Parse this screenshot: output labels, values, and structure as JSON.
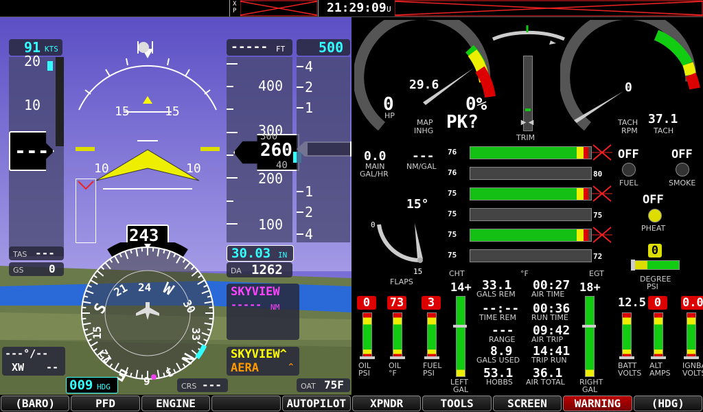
{
  "topbar": {
    "xp_label": "X P",
    "clock": "21:29:09",
    "clock_suffix": "U"
  },
  "pfd": {
    "airspeed": {
      "value": "91",
      "unit": "KTS",
      "pointer": "---",
      "ticks": [
        "20",
        "10"
      ]
    },
    "altitude": {
      "selected": "-----",
      "selected_unit": "FT",
      "vs_bug": "500",
      "ticks": [
        "400",
        "300",
        "200",
        "100"
      ],
      "current": "260",
      "roll_above": "300",
      "roll_below": "40"
    },
    "vsi_ticks": [
      "4",
      "2",
      "1",
      "1",
      "2",
      "4"
    ],
    "pitch_labels": {
      "up15_left": "15",
      "up15_right": "15",
      "down10_left": "10",
      "down10_right": "10"
    },
    "tas": {
      "label": "TAS",
      "value": "---"
    },
    "gs": {
      "label": "GS",
      "value": "0"
    },
    "baro": {
      "value": "30.03",
      "unit": "IN"
    },
    "da": {
      "label": "DA",
      "value": "1262"
    },
    "heading": {
      "value": "243",
      "bug": "009",
      "bug_unit": "HDG",
      "labels": [
        "24",
        "W",
        "30",
        "33",
        "N",
        "3",
        "E",
        "12",
        "15",
        "S",
        "21",
        "6"
      ]
    },
    "nav": {
      "source": "SKYVIEW",
      "dist": "-----",
      "dist_unit": "NM"
    },
    "nav2": {
      "line1": "SKYVIEW^",
      "line2": "AERA"
    },
    "wind": {
      "line1": "---°/--",
      "xw_label": "XW",
      "xw_value": "--"
    },
    "crs": {
      "label": "CRS",
      "value": "---"
    },
    "oat": {
      "label": "OAT",
      "value": "75F"
    }
  },
  "engine": {
    "map": {
      "value": "29.6",
      "label1": "MAP",
      "label2": "INHG"
    },
    "hp": {
      "value": "0",
      "label": "HP"
    },
    "pct": {
      "value": "0%",
      "peak": "PK?"
    },
    "trim": {
      "label": "TRIM"
    },
    "tach": {
      "needle": "0",
      "value": "37.1",
      "label1": "TACH",
      "label2": "RPM",
      "label_right": "TACH"
    },
    "fuel_flow": {
      "value": "0.0",
      "label1": "MAIN",
      "label2": "GAL/HR"
    },
    "nm_gal": {
      "value": "---",
      "label": "NM/GAL"
    },
    "cyl": {
      "cht": [
        "76",
        "76",
        "75",
        "75",
        "75",
        "75"
      ],
      "egt": [
        "",
        "80",
        "",
        "75",
        "",
        "72"
      ],
      "fill": [
        0.98,
        0,
        0.98,
        0,
        0.98,
        0
      ],
      "cht_label": "CHT",
      "unit_label": "°F",
      "egt_label": "EGT"
    },
    "flaps": {
      "deg": "15°",
      "min": "0",
      "max": "15",
      "label": "FLAPS"
    },
    "fuel_pump": {
      "state": "OFF",
      "label": "FUEL"
    },
    "smoke": {
      "state": "OFF",
      "label": "SMOKE"
    },
    "pheat": {
      "state": "OFF",
      "label": "PHEAT"
    },
    "degree": {
      "value": "0",
      "label1": "DEGREE",
      "label2": "PSI"
    },
    "oil_psi": {
      "value": "0",
      "label1": "OIL",
      "label2": "PSI"
    },
    "oil_f": {
      "value": "73",
      "label1": "OIL",
      "label2": "°F"
    },
    "fuel_psi": {
      "value": "3",
      "label1": "FUEL",
      "label2": "PSI"
    },
    "left_gal": {
      "value": "14+",
      "label1": "LEFT",
      "label2": "GAL"
    },
    "right_gal": {
      "value": "18+",
      "label1": "RIGHT",
      "label2": "GAL"
    },
    "batt": {
      "value": "12.5",
      "label1": "BATT",
      "label2": "VOLTS"
    },
    "alt": {
      "value": "0",
      "label1": "ALT",
      "label2": "AMPS"
    },
    "ignbat": {
      "value": "0.0",
      "label1": "IGNBAT",
      "label2": "VOLTS"
    },
    "center": {
      "gals_rem": "33.1",
      "gals_rem_label": "GALS REM",
      "air_time": "00:27",
      "air_time_label": "AIR TIME",
      "time_rem": "--:--",
      "time_rem_label": "TIME REM",
      "run_time": "00:36",
      "run_time_label": "RUN TIME",
      "range": "---",
      "range_label": "RANGE",
      "air_trip": "09:42",
      "air_trip_label": "AIR TRIP",
      "gals_used": "8.9",
      "gals_used_label": "GALS USED",
      "trip_run": "14:41",
      "trip_run_label": "TRIP RUN",
      "hobbs": "53.1",
      "hobbs_label": "HOBBS",
      "air_total": "36.1",
      "air_total_label": "AIR TOTAL"
    }
  },
  "bottom_buttons": [
    "(BARO)",
    "PFD",
    "ENGINE",
    "",
    "AUTOPILOT",
    "XPNDR",
    "TOOLS",
    "SCREEN",
    "WARNING",
    "(HDG)"
  ],
  "colors": {
    "cyan": "#33ffff",
    "sky": "#7a6fd6",
    "ground": "#6b7a4a",
    "warning": "#b00000",
    "magenta": "#ff44ff",
    "yellow": "#ffff00"
  }
}
